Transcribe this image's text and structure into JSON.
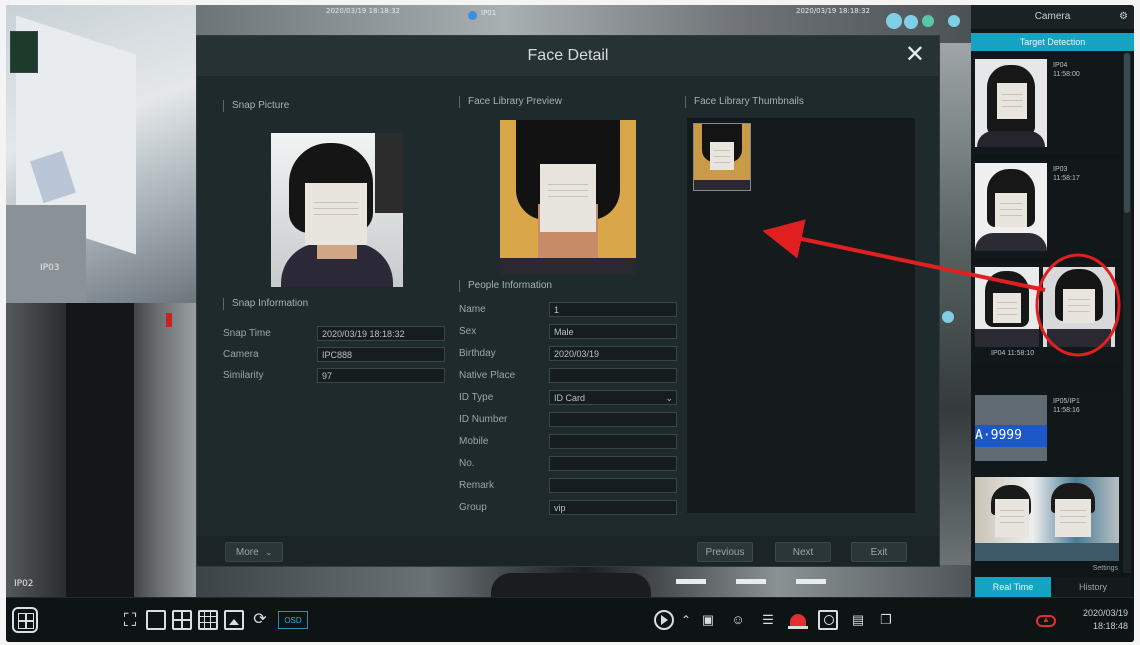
{
  "cameras": {
    "top_overlay_1": "2020/03/19 18:18:32",
    "top_overlay_2": "IP01",
    "top_overlay_3": "2020/03/19 18:18:32",
    "tile1_label": "IP03",
    "tile2_label": "IP02"
  },
  "dialog": {
    "title": "Face Detail",
    "close_glyph": "✕",
    "snap_picture": "Snap Picture",
    "face_library_preview": "Face Library Preview",
    "face_library_thumbnails": "Face Library Thumbnails",
    "snap_information": "Snap Information",
    "people_information": "People Information",
    "snap": {
      "snap_time_label": "Snap Time",
      "snap_time_value": "2020/03/19 18:18:32",
      "camera_label": "Camera",
      "camera_value": "IPC888",
      "similarity_label": "Similarity",
      "similarity_value": "97"
    },
    "people": {
      "name_label": "Name",
      "name_value": "1",
      "sex_label": "Sex",
      "sex_value": "Male",
      "birthday_label": "Birthday",
      "birthday_value": "2020/03/19",
      "native_place_label": "Native Place",
      "native_place_value": "",
      "id_type_label": "ID Type",
      "id_type_value": "ID Card",
      "id_number_label": "ID Number",
      "id_number_value": "",
      "mobile_label": "Mobile",
      "mobile_value": "",
      "no_label": "No.",
      "no_value": "",
      "remark_label": "Remark",
      "remark_value": "",
      "group_label": "Group",
      "group_value": "vip"
    },
    "footer": {
      "more": "More",
      "previous": "Previous",
      "next": "Next",
      "exit": "Exit"
    }
  },
  "right_panel": {
    "header": "Camera",
    "tab": "Target Detection",
    "items": [
      {
        "camera": "IP04",
        "time": "11:58:00"
      },
      {
        "camera": "IP03",
        "time": "11:58:17"
      },
      {
        "camera": "IP04",
        "time": "11:58:10"
      },
      {
        "camera": "IP05/IP1",
        "time": "11:58:16"
      },
      {
        "plate": "A·9999"
      }
    ],
    "settings": "Settings",
    "real_time": "Real Time",
    "history": "History"
  },
  "taskbar": {
    "osd": "OSD",
    "date": "2020/03/19",
    "time": "18:18:48"
  },
  "colors": {
    "accent": "#16a3c3",
    "annotation_red": "#e02020"
  }
}
